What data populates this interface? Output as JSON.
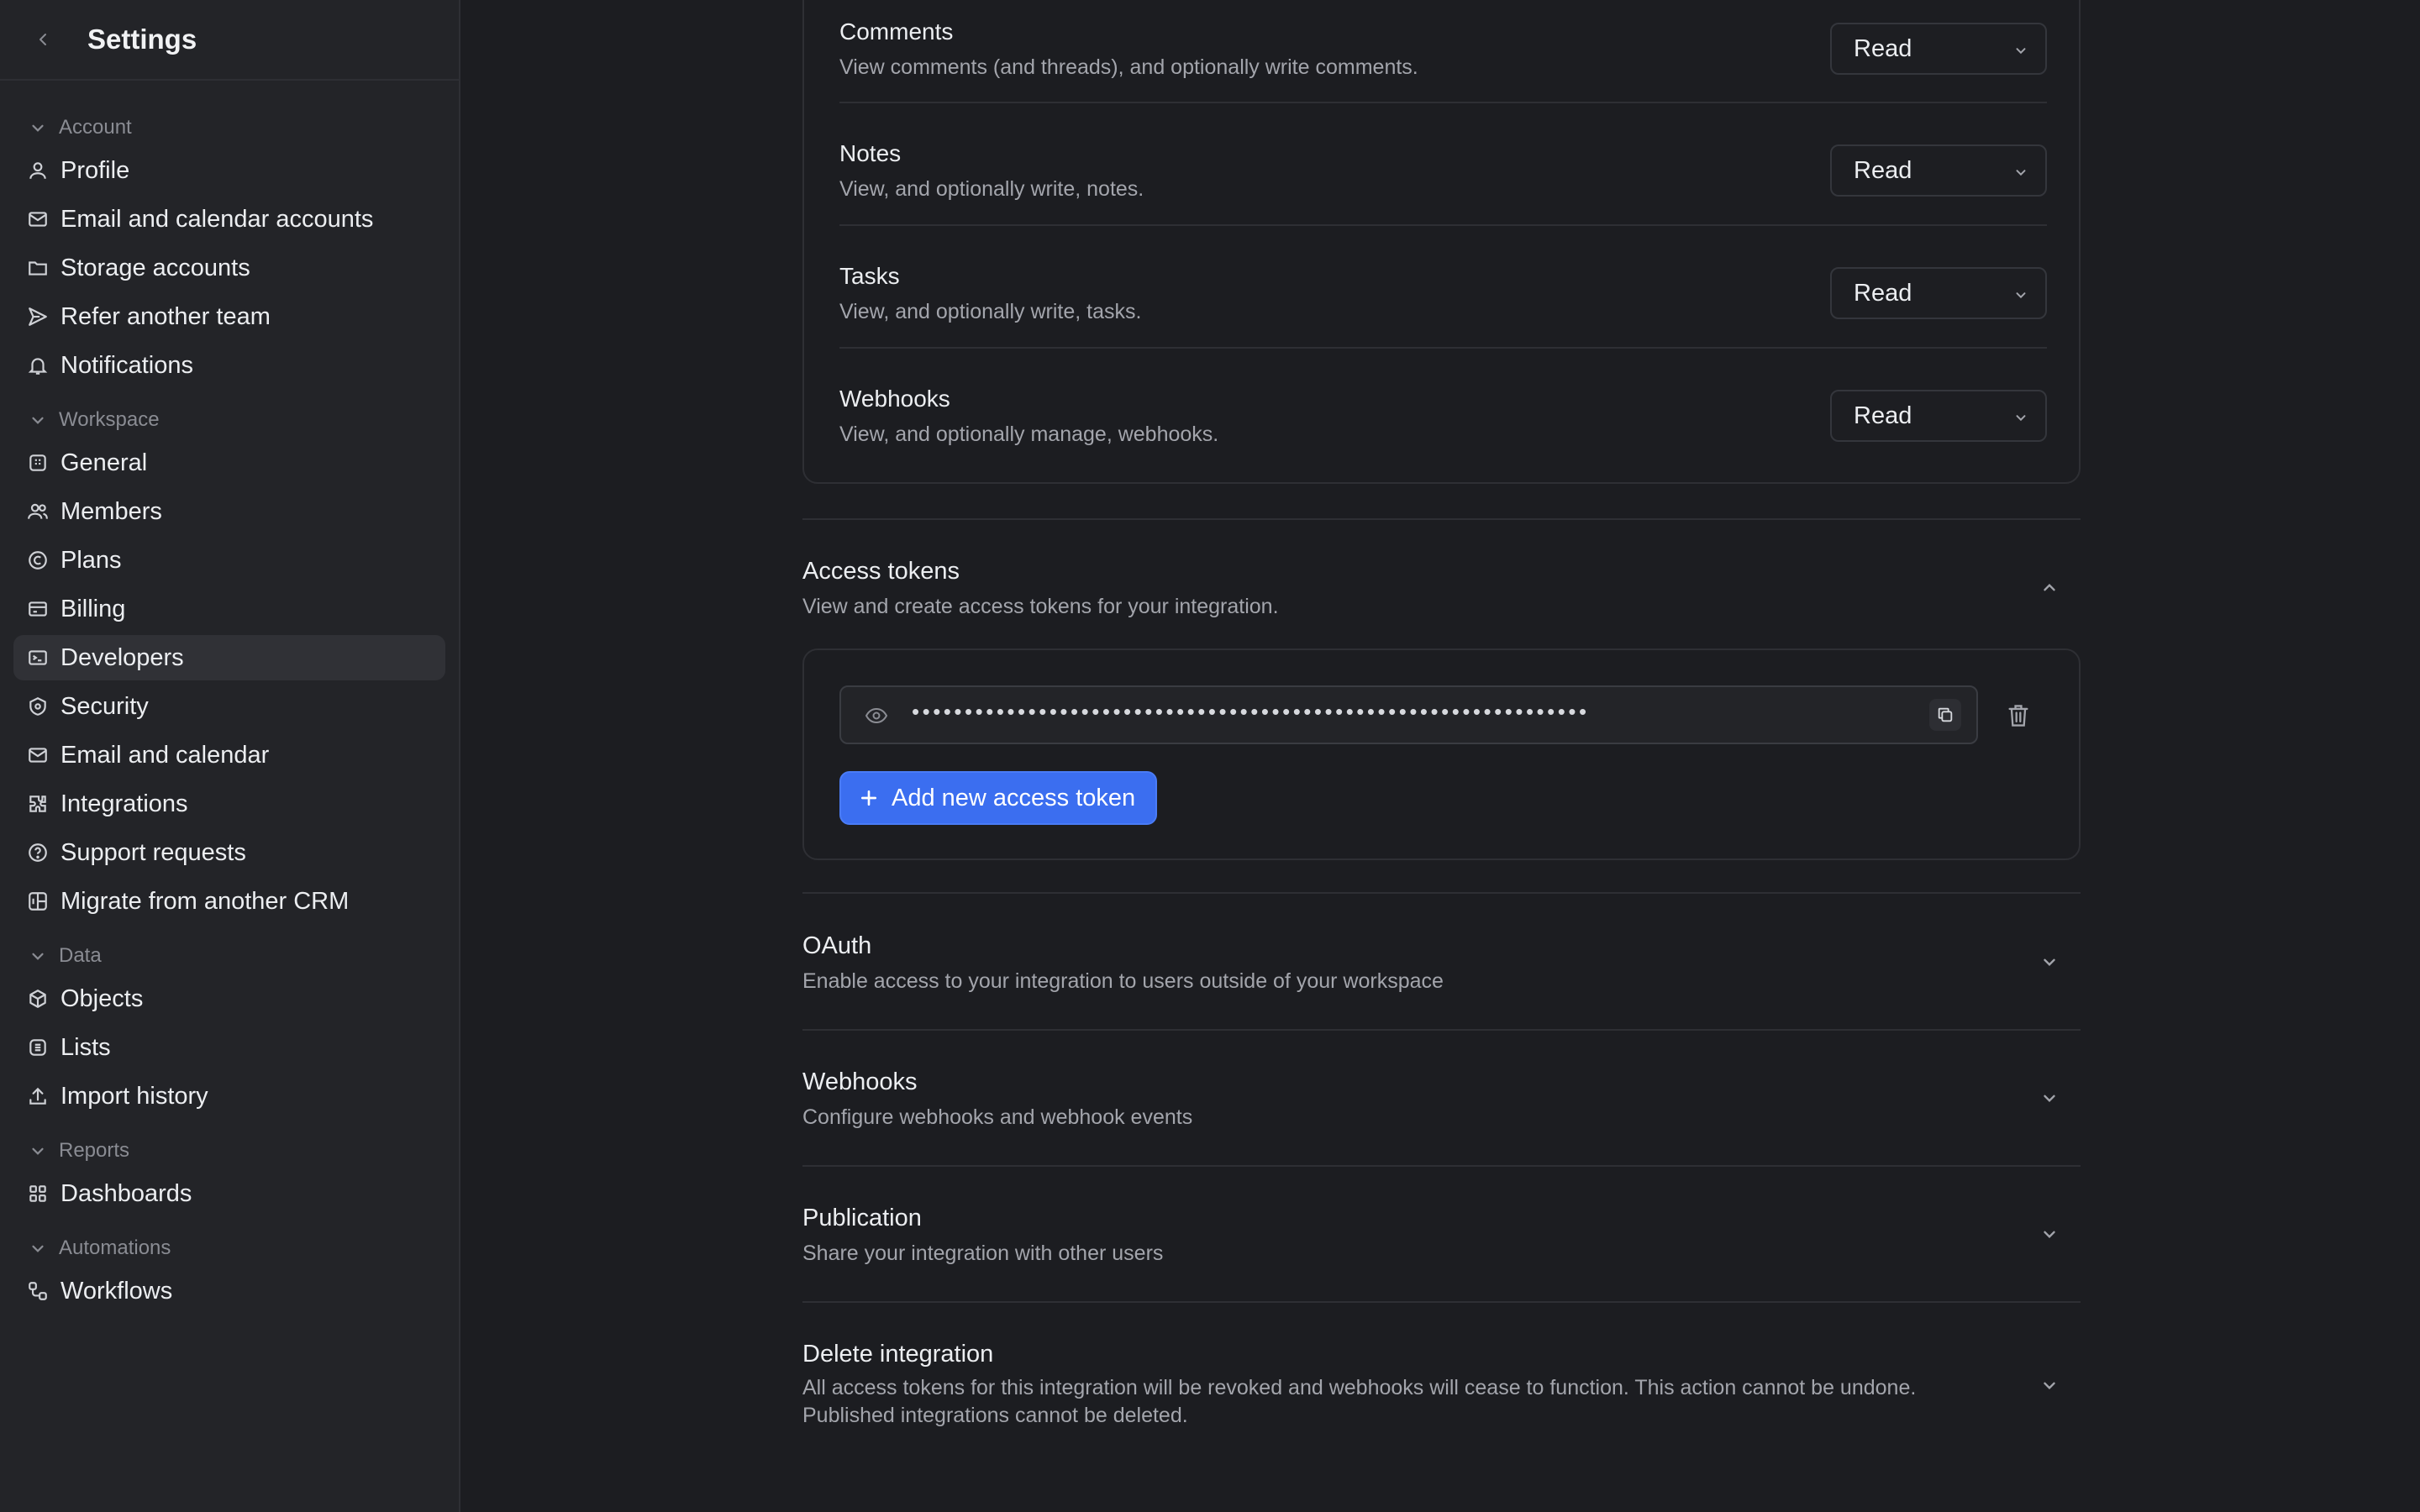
{
  "sidebar": {
    "title": "Settings",
    "groups": [
      {
        "label": "Account",
        "items": [
          {
            "label": "Profile",
            "icon": "user-icon"
          },
          {
            "label": "Email and calendar accounts",
            "icon": "mail-icon"
          },
          {
            "label": "Storage accounts",
            "icon": "folder-icon"
          },
          {
            "label": "Refer another team",
            "icon": "send-icon"
          },
          {
            "label": "Notifications",
            "icon": "bell-icon"
          }
        ]
      },
      {
        "label": "Workspace",
        "items": [
          {
            "label": "General",
            "icon": "building-icon"
          },
          {
            "label": "Members",
            "icon": "users-icon"
          },
          {
            "label": "Plans",
            "icon": "plan-icon"
          },
          {
            "label": "Billing",
            "icon": "credit-card-icon"
          },
          {
            "label": "Developers",
            "icon": "terminal-icon",
            "active": true
          },
          {
            "label": "Security",
            "icon": "shield-icon"
          },
          {
            "label": "Email and calendar",
            "icon": "mail-icon"
          },
          {
            "label": "Integrations",
            "icon": "puzzle-icon"
          },
          {
            "label": "Support requests",
            "icon": "help-icon"
          },
          {
            "label": "Migrate from another CRM",
            "icon": "migrate-icon"
          }
        ]
      },
      {
        "label": "Data",
        "items": [
          {
            "label": "Objects",
            "icon": "cube-icon"
          },
          {
            "label": "Lists",
            "icon": "list-icon"
          },
          {
            "label": "Import history",
            "icon": "upload-icon"
          }
        ]
      },
      {
        "label": "Reports",
        "items": [
          {
            "label": "Dashboards",
            "icon": "dashboard-icon"
          }
        ]
      },
      {
        "label": "Automations",
        "items": [
          {
            "label": "Workflows",
            "icon": "workflow-icon"
          }
        ]
      }
    ]
  },
  "permissions": [
    {
      "title": "Comments",
      "desc": "View comments (and threads), and optionally write comments.",
      "value": "Read"
    },
    {
      "title": "Notes",
      "desc": "View, and optionally write, notes.",
      "value": "Read"
    },
    {
      "title": "Tasks",
      "desc": "View, and optionally write, tasks.",
      "value": "Read"
    },
    {
      "title": "Webhooks",
      "desc": "View, and optionally manage, webhooks.",
      "value": "Read"
    }
  ],
  "access_tokens": {
    "title": "Access tokens",
    "desc": "View and create access tokens for your integration.",
    "token_masked": "••••••••••••••••••••••••••••••••••••••••••••••••••••••••••••••••",
    "add_label": "Add new access token"
  },
  "sections": [
    {
      "title": "OAuth",
      "desc": "Enable access to your integration to users outside of your workspace"
    },
    {
      "title": "Webhooks",
      "desc": "Configure webhooks and webhook events"
    },
    {
      "title": "Publication",
      "desc": "Share your integration with other users"
    },
    {
      "title": "Delete integration",
      "desc": "All access tokens for this integration will be revoked and webhooks will cease to function. This action cannot be undone. Published integrations cannot be deleted."
    }
  ],
  "colors": {
    "accent": "#3b6ef0",
    "background": "#1c1d21",
    "sidebar": "#232428"
  }
}
